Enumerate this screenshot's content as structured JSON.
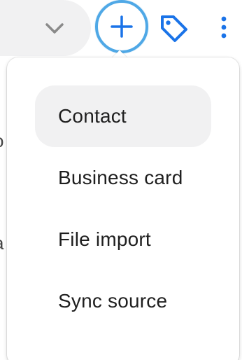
{
  "toolbar": {
    "chevron_icon": "chevron-down-icon",
    "add_icon": "plus-icon",
    "tag_icon": "tag-icon",
    "more_icon": "more-vertical-icon",
    "accent_color": "#1a73e8",
    "focus_ring_color": "#4fa8e6"
  },
  "background": {
    "fragment_1": "o",
    "fragment_2": "a"
  },
  "menu": {
    "items": [
      {
        "label": "Contact",
        "selected": true
      },
      {
        "label": "Business card",
        "selected": false
      },
      {
        "label": "File import",
        "selected": false
      },
      {
        "label": "Sync source",
        "selected": false
      }
    ]
  }
}
